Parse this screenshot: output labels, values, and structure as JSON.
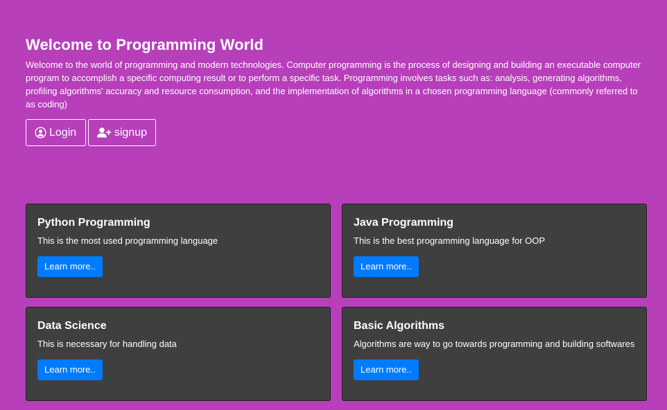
{
  "hero": {
    "title": "Welcome to Programming World",
    "text": "Welcome to the world of programming and modern technologies. Computer programming is the process of designing and building an executable computer program to accomplish a specific computing result or to perform a specific task. Programming involves tasks such as: analysis, generating algorithms, profiling algorithms' accuracy and resource consumption, and the implementation of algorithms in a chosen programming language (commonly referred to as coding)",
    "login_label": "Login",
    "login_icon": "user-circle-icon",
    "signup_label": "signup",
    "signup_icon": "user-plus-icon"
  },
  "cards": [
    {
      "title": "Python Programming",
      "text": "This is the most used programming language",
      "button_label": "Learn more.."
    },
    {
      "title": "Java Programming",
      "text": "This is the best programming language for OOP",
      "button_label": "Learn more.."
    },
    {
      "title": "Data Science",
      "text": "This is necessary for handling data",
      "button_label": "Learn more.."
    },
    {
      "title": "Basic Algorithms",
      "text": "Algorithms are way to go towards programming and building softwares",
      "button_label": "Learn more.."
    }
  ],
  "colors": {
    "background": "#b73fba",
    "card": "#3f3f3f",
    "primary_button": "#007bff",
    "text": "#ffffff"
  }
}
